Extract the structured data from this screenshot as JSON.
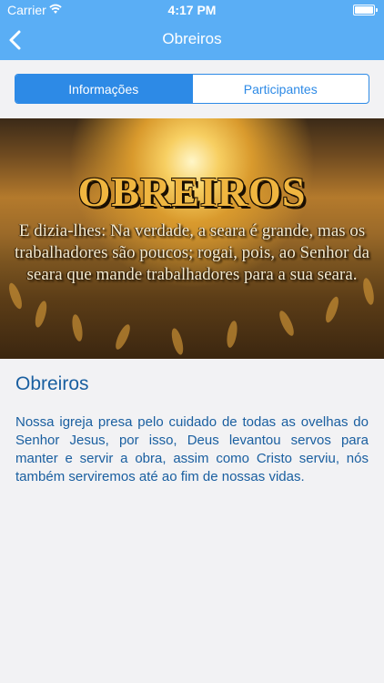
{
  "status_bar": {
    "carrier": "Carrier",
    "time": "4:17 PM"
  },
  "navbar": {
    "title": "Obreiros",
    "back_icon": "chevron-left-icon"
  },
  "segments": [
    {
      "label": "Informações",
      "active": true
    },
    {
      "label": "Participantes",
      "active": false
    }
  ],
  "banner": {
    "title": "OBREIROS",
    "verse": "E dizia-lhes: Na verdade, a seara é grande, mas os trabalhadores são poucos; rogai, pois, ao Senhor da seara que mande trabalhadores para a sua seara."
  },
  "content": {
    "title": "Obreiros",
    "text": "Nossa igreja presa pelo cuidado de todas as ovelhas do Senhor Jesus, por isso, Deus levantou servos para manter e servir a obra, assim como Cristo serviu, nós também serviremos até ao fim de nossas vidas."
  },
  "colors": {
    "nav_background": "#5aaef5",
    "accent": "#2d8ae6",
    "text_blue": "#1a5fa0",
    "page_background": "#f2f2f4"
  }
}
